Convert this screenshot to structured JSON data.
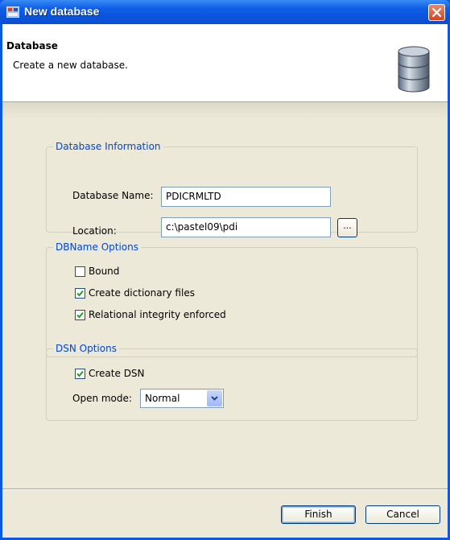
{
  "window": {
    "title": "New database"
  },
  "banner": {
    "title": "Database",
    "subtitle": "Create a new database."
  },
  "groups": {
    "database_info": {
      "legend": "Database Information",
      "name_label": "Database Name:",
      "name_value": "PDICRMLTD",
      "location_label": "Location:",
      "location_value": "c:\\pastel09\\pdi",
      "browse_label": "..."
    },
    "dbname_options": {
      "legend": "DBName Options",
      "items": [
        {
          "label": "Bound",
          "checked": false
        },
        {
          "label": "Create dictionary files",
          "checked": true
        },
        {
          "label": "Relational integrity enforced",
          "checked": true
        }
      ]
    },
    "dsn_options": {
      "legend": "DSN Options",
      "create_dsn": {
        "label": "Create DSN",
        "checked": true
      },
      "open_mode_label": "Open mode:",
      "open_mode_value": "Normal"
    }
  },
  "buttons": {
    "finish": "Finish",
    "cancel": "Cancel"
  },
  "icons": {
    "title": "app-icon",
    "close": "close-icon",
    "banner": "database-icon",
    "check": "checkmark-icon",
    "dropdown": "chevron-down-icon"
  },
  "colors": {
    "title_bar": "#0a54dc",
    "legend_text": "#0046d5",
    "dialog_bg": "#ece9d8",
    "check_mark": "#21a121"
  }
}
